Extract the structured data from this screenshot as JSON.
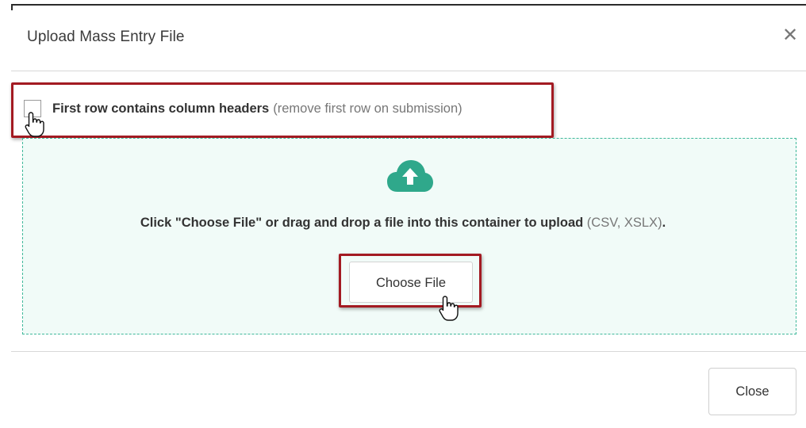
{
  "modal": {
    "title": "Upload Mass Entry File",
    "close_icon": "close-icon"
  },
  "checkbox": {
    "label": "First row contains column headers",
    "hint": "(remove first row on submission)",
    "checked": false
  },
  "dropzone": {
    "icon": "cloud-upload-icon",
    "instruction": "Click \"Choose File\" or drag and drop a file into this container to upload",
    "file_types": "(CSV, XSLX)",
    "period": ".",
    "choose_label": "Choose File"
  },
  "footer": {
    "close_label": "Close"
  },
  "colors": {
    "accent_green": "#3fb89a",
    "highlight_red": "#a31a22"
  }
}
